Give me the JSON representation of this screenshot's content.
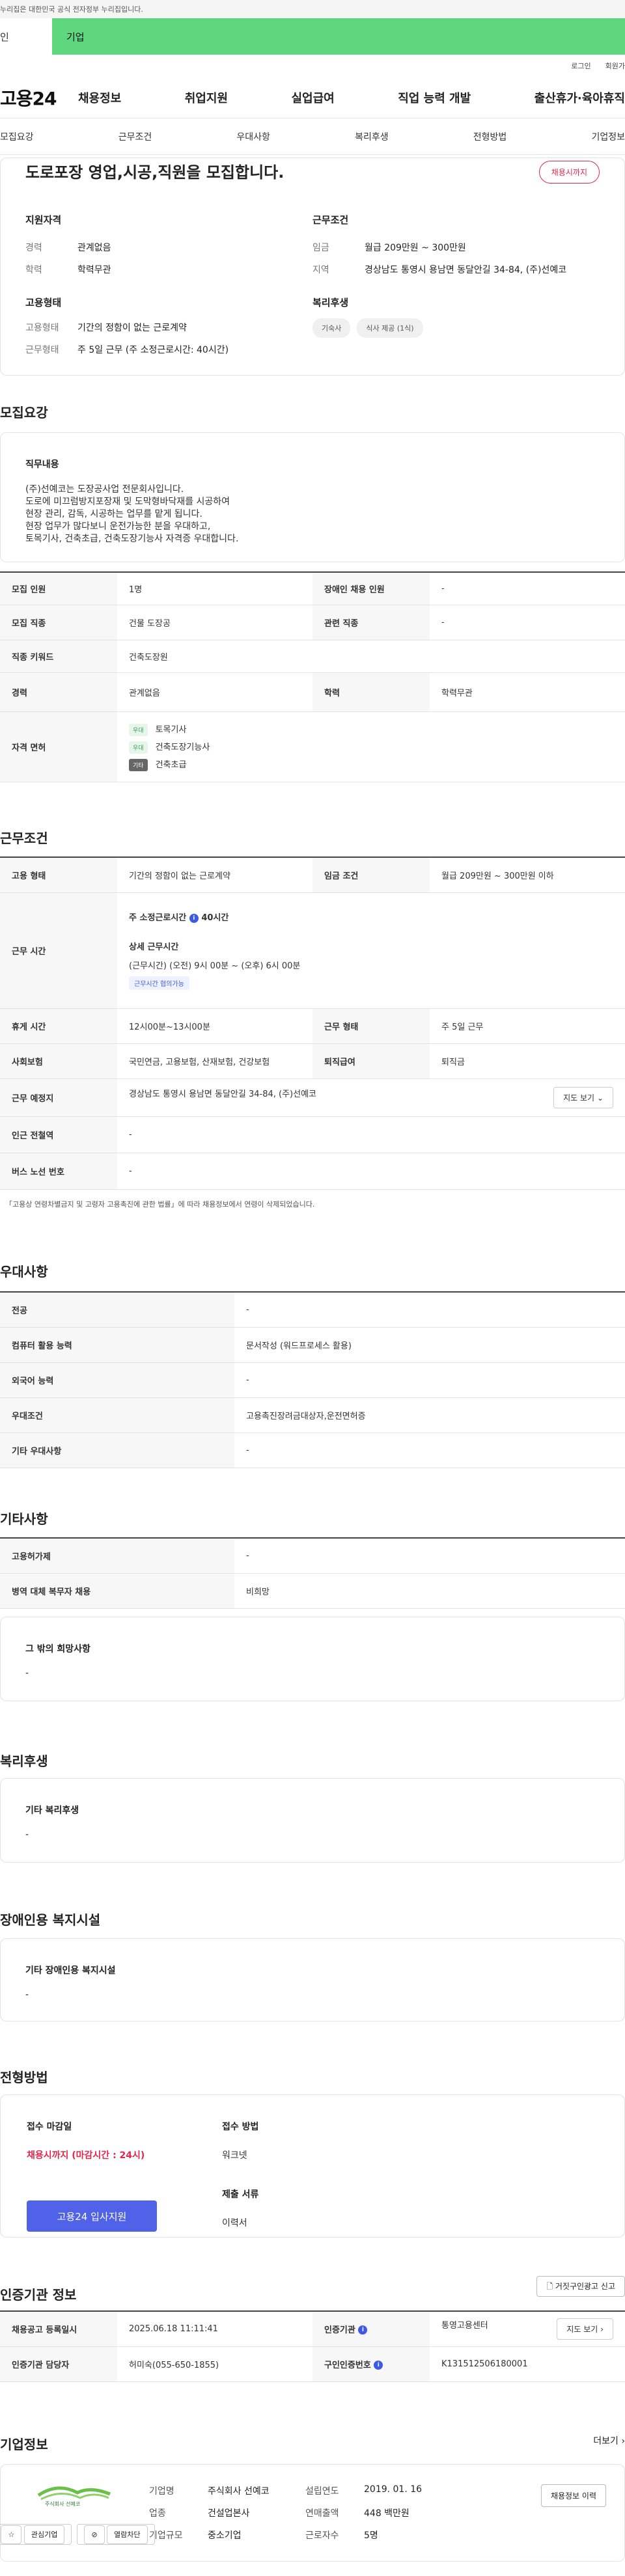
{
  "gov_banner": "누리집은 대한민국 공식 전자정부 누리집입니다.",
  "top_tabs": {
    "individual": "인",
    "corporate": "기업"
  },
  "util": {
    "login": "로그인",
    "signup": "회원가"
  },
  "brand": {
    "logo": "고용24"
  },
  "gnb": [
    "채용정보",
    "취업지원",
    "실업급여",
    "직업 능력 개발",
    "출산휴가·육아휴직"
  ],
  "sub_nav": [
    "모집요강",
    "근무조건",
    "우대사항",
    "복리후생",
    "전형방법",
    "기업정보"
  ],
  "summary": {
    "title": "도로포장 영업,시공,직원을 모집합니다.",
    "status": "채용시까지",
    "qualification_heading": "지원자격",
    "career_key": "경력",
    "career_value": "관계없음",
    "education_key": "학력",
    "education_value": "학력무관",
    "employment_heading": "고용형태",
    "emp_type_key": "고용형태",
    "emp_type_value": "기간의 정함이 없는 근로계약",
    "work_type_key": "근무형태",
    "work_type_value": "주 5일 근무 (주 소정근로시간: 40시간)",
    "conditions_heading": "근무조건",
    "wage_key": "임금",
    "wage_value": "월급 209만원 ~ 300만원",
    "region_key": "지역",
    "region_value": "경상남도 통영시 용남면 동달안길 34-84, (주)선예코",
    "welfare_heading": "복리후생",
    "welfare_chips": [
      "기숙사",
      "식사 제공 (1식)"
    ]
  },
  "recruit": {
    "section_title": "모집요강",
    "duty_heading": "직무내용",
    "duty_lines": [
      "(주)선예코는 도장공사업 전문회사입니다.",
      "도로에 미끄럼방지포장재 및 도막형바닥재를 시공하여",
      "현장 관리, 감독, 시공하는 업무를 맡게 됩니다.",
      "현장 업무가 많다보니 운전가능한 분을 우대하고,",
      "토목기사, 건축초급, 건축도장기능사 자격증 우대합니다."
    ],
    "headcount_label": "모집 인원",
    "headcount_value": "1명",
    "disabled_label": "장애인 채용 인원",
    "disabled_value": "-",
    "job_label": "모집 직종",
    "job_value": "건물 도장공",
    "related_label": "관련 직종",
    "related_value": "-",
    "keyword_label": "직종 키워드",
    "keyword_value": "건축도장원",
    "career_label": "경력",
    "career_value": "관계없음",
    "edu_label": "학력",
    "edu_value": "학력무관",
    "license_label": "자격 면허",
    "licenses": [
      {
        "badge": "우대",
        "name": "토목기사"
      },
      {
        "badge": "우대",
        "name": "건축도장기능사"
      },
      {
        "badge": "기타",
        "name": "건축초급"
      }
    ]
  },
  "work": {
    "section_title": "근무조건",
    "emp_type_label": "고용 형태",
    "emp_type_value": "기간의 정함이 없는 근로계약",
    "wage_label": "임금 조건",
    "wage_value": "월급 209만원 ~ 300만원 이하",
    "hours_label": "근무 시간",
    "hours_main": "주 소정근로시간",
    "hours_main_value": "40시간",
    "hours_detail_heading": "상세 근무시간",
    "hours_detail": "(근무시간) (오전) 9시 00분 ~ (오후) 6시 00분",
    "hours_badge": "근무시간 협의가능",
    "break_label": "휴게 시간",
    "break_value": "12시00분~13시00분",
    "worktype_label": "근무 형태",
    "worktype_value": "주 5일 근무",
    "insurance_label": "사회보험",
    "insurance_value": "국민연금, 고용보험, 산재보험, 건강보험",
    "severance_label": "퇴직급여",
    "severance_value": "퇴직금",
    "place_label": "근무 예정지",
    "place_value": "경상남도 통영시 용남면 동달안길 34-84, (주)선예코",
    "map_btn": "지도 보기",
    "subway_label": "인근 전철역",
    "subway_value": "-",
    "bus_label": "버스 노선 번호",
    "bus_value": "-",
    "footnote": "「고용상 연령차별금지 및 고령자 고용촉진에 관한 법률」에 따라 채용정보에서 연령이 삭제되었습니다."
  },
  "preference": {
    "section_title": "우대사항",
    "major_label": "전공",
    "major_value": "-",
    "computer_label": "컴퓨터 활용 능력",
    "computer_value": "문서작성 (워드프로세스 활용)",
    "language_label": "외국어 능력",
    "language_value": "-",
    "condition_label": "우대조건",
    "condition_value": "고용촉진장려금대상자,운전면허증",
    "other_label": "기타 우대사항",
    "other_value": "-"
  },
  "etc": {
    "section_title": "기타사항",
    "permit_label": "고용허가제",
    "permit_value": "-",
    "military_label": "병역 대체 복무자 채용",
    "military_value": "비희망",
    "other_heading": "그 밖의 희망사항",
    "other_value": "-"
  },
  "welfare": {
    "section_title": "복리후생",
    "heading": "기타 복리후생",
    "value": "-"
  },
  "facility": {
    "section_title": "장애인용 복지시설",
    "heading": "기타 장애인용 복지시설",
    "value": "-"
  },
  "process": {
    "section_title": "전형방법",
    "deadline_heading": "접수 마감일",
    "deadline_value": "채용시까지 (마감시간 : 24시)",
    "method_heading": "접수 방법",
    "method_value": "워크넷",
    "docs_heading": "제출 서류",
    "docs_value": "이력서",
    "apply_btn": "고용24 입사지원"
  },
  "agency": {
    "section_title": "인증기관 정보",
    "report_btn": "거짓구인광고 신고",
    "reg_label": "채용공고 등록일시",
    "reg_value": "2025.06.18 11:11:41",
    "agency_label": "인증기관",
    "agency_value": "통영고용센터",
    "map_btn": "지도 보기",
    "manager_label": "인증기관 담당자",
    "manager_value": "허미숙(055-650-1855)",
    "id_label": "구인인증번호",
    "id_value": "K131512506180001"
  },
  "company": {
    "section_title": "기업정보",
    "more": "더보기",
    "logo_text": "주식회사 선예코",
    "interest_btn": "관심기업",
    "block_btn": "열람차단",
    "history_btn": "채용정보 이력",
    "name_label": "기업명",
    "name_value": "주식회사 선예코",
    "industry_label": "업종",
    "industry_value": "건설업본사",
    "scale_label": "기업규모",
    "scale_value": "중소기업",
    "founded_label": "설립연도",
    "founded_value": "2019. 01. 16",
    "sales_label": "연매출액",
    "sales_value": "448 백만원",
    "staff_label": "근로자수",
    "staff_value": "5명"
  }
}
